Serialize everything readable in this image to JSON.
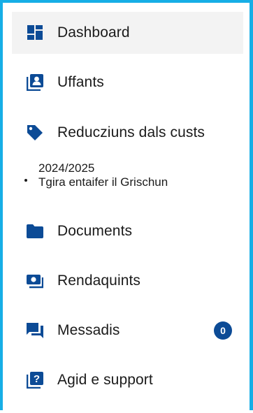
{
  "colors": {
    "accent_border": "#17aee6",
    "icon_blue": "#0c4b96",
    "active_bg": "#f3f3f3",
    "text": "#1b1b1b"
  },
  "nav": {
    "items": [
      {
        "label": "Dashboard",
        "icon": "dashboard-icon",
        "active": true
      },
      {
        "label": "Uffants",
        "icon": "children-contact-icon"
      },
      {
        "label": "Reducziuns dals custs",
        "icon": "price-tag-icon"
      },
      {
        "label": "Documents",
        "icon": "folder-icon"
      },
      {
        "label": "Rendaquints",
        "icon": "payments-icon"
      },
      {
        "label": "Messadis",
        "icon": "messages-icon",
        "badge": "0"
      },
      {
        "label": "Agid e support",
        "icon": "help-icon"
      }
    ],
    "year_group": {
      "year": "2024/2025",
      "subtitle": "Tgira entaifer il Grischun"
    }
  }
}
